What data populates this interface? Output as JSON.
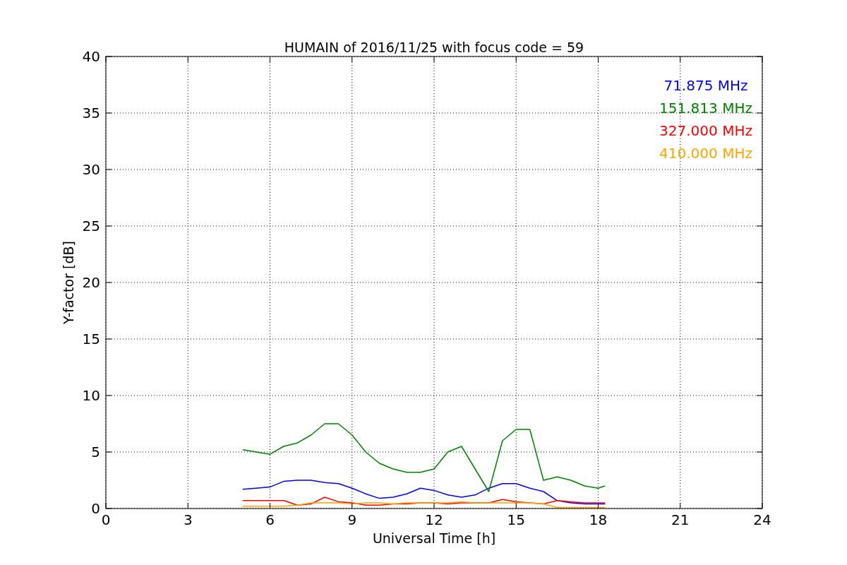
{
  "chart_data": {
    "type": "line",
    "title": "HUMAIN of 2016/11/25 with focus code = 59",
    "xlabel": "Universal Time [h]",
    "ylabel": "Y-factor [dB]",
    "x": [
      5,
      5.5,
      6,
      6.5,
      7,
      7.5,
      8,
      8.5,
      9,
      9.5,
      10,
      10.5,
      11,
      11.5,
      12,
      12.5,
      13,
      13.5,
      14,
      14.5,
      15,
      15.5,
      16,
      16.5,
      17,
      17.5,
      18,
      18.25
    ],
    "series": [
      {
        "name": "71.875 MHz",
        "color": "#0000ff",
        "values": [
          1.7,
          1.8,
          1.9,
          2.4,
          2.5,
          2.5,
          2.3,
          2.2,
          1.8,
          1.3,
          0.9,
          1.0,
          1.3,
          1.8,
          1.6,
          1.2,
          1.0,
          1.2,
          1.8,
          2.2,
          2.2,
          1.8,
          1.5,
          0.7,
          0.5,
          0.4,
          0.4,
          0.4
        ]
      },
      {
        "name": "151.813 MHz",
        "color": "#008000",
        "values": [
          5.2,
          5.0,
          4.8,
          5.5,
          5.8,
          6.5,
          7.5,
          7.5,
          6.5,
          5.0,
          4.0,
          3.5,
          3.2,
          3.2,
          3.5,
          5.0,
          5.5,
          3.5,
          1.5,
          6.0,
          7.0,
          7.0,
          2.5,
          2.8,
          2.5,
          2.0,
          1.8,
          2.0
        ]
      },
      {
        "name": "327.000 MHz",
        "color": "#ff0000",
        "values": [
          0.7,
          0.7,
          0.7,
          0.7,
          0.3,
          0.4,
          1.0,
          0.6,
          0.5,
          0.3,
          0.3,
          0.4,
          0.4,
          0.5,
          0.5,
          0.4,
          0.5,
          0.5,
          0.5,
          0.8,
          0.6,
          0.5,
          0.4,
          0.7,
          0.6,
          0.5,
          0.5,
          0.5
        ]
      },
      {
        "name": "410.000 MHz",
        "color": "#ffa500",
        "values": [
          0.2,
          0.2,
          0.2,
          0.2,
          0.3,
          0.5,
          0.5,
          0.5,
          0.4,
          0.5,
          0.5,
          0.4,
          0.5,
          0.5,
          0.5,
          0.5,
          0.6,
          0.5,
          0.5,
          0.5,
          0.5,
          0.5,
          0.4,
          0.1,
          0.1,
          0.1,
          0.1,
          0.1
        ]
      }
    ],
    "grid": true,
    "xlim": [
      0,
      24
    ],
    "ylim": [
      0,
      40
    ],
    "xticks": [
      0,
      3,
      6,
      9,
      12,
      15,
      18,
      21,
      24
    ],
    "yticks": [
      0,
      5,
      10,
      15,
      20,
      25,
      30,
      35,
      40
    ]
  }
}
